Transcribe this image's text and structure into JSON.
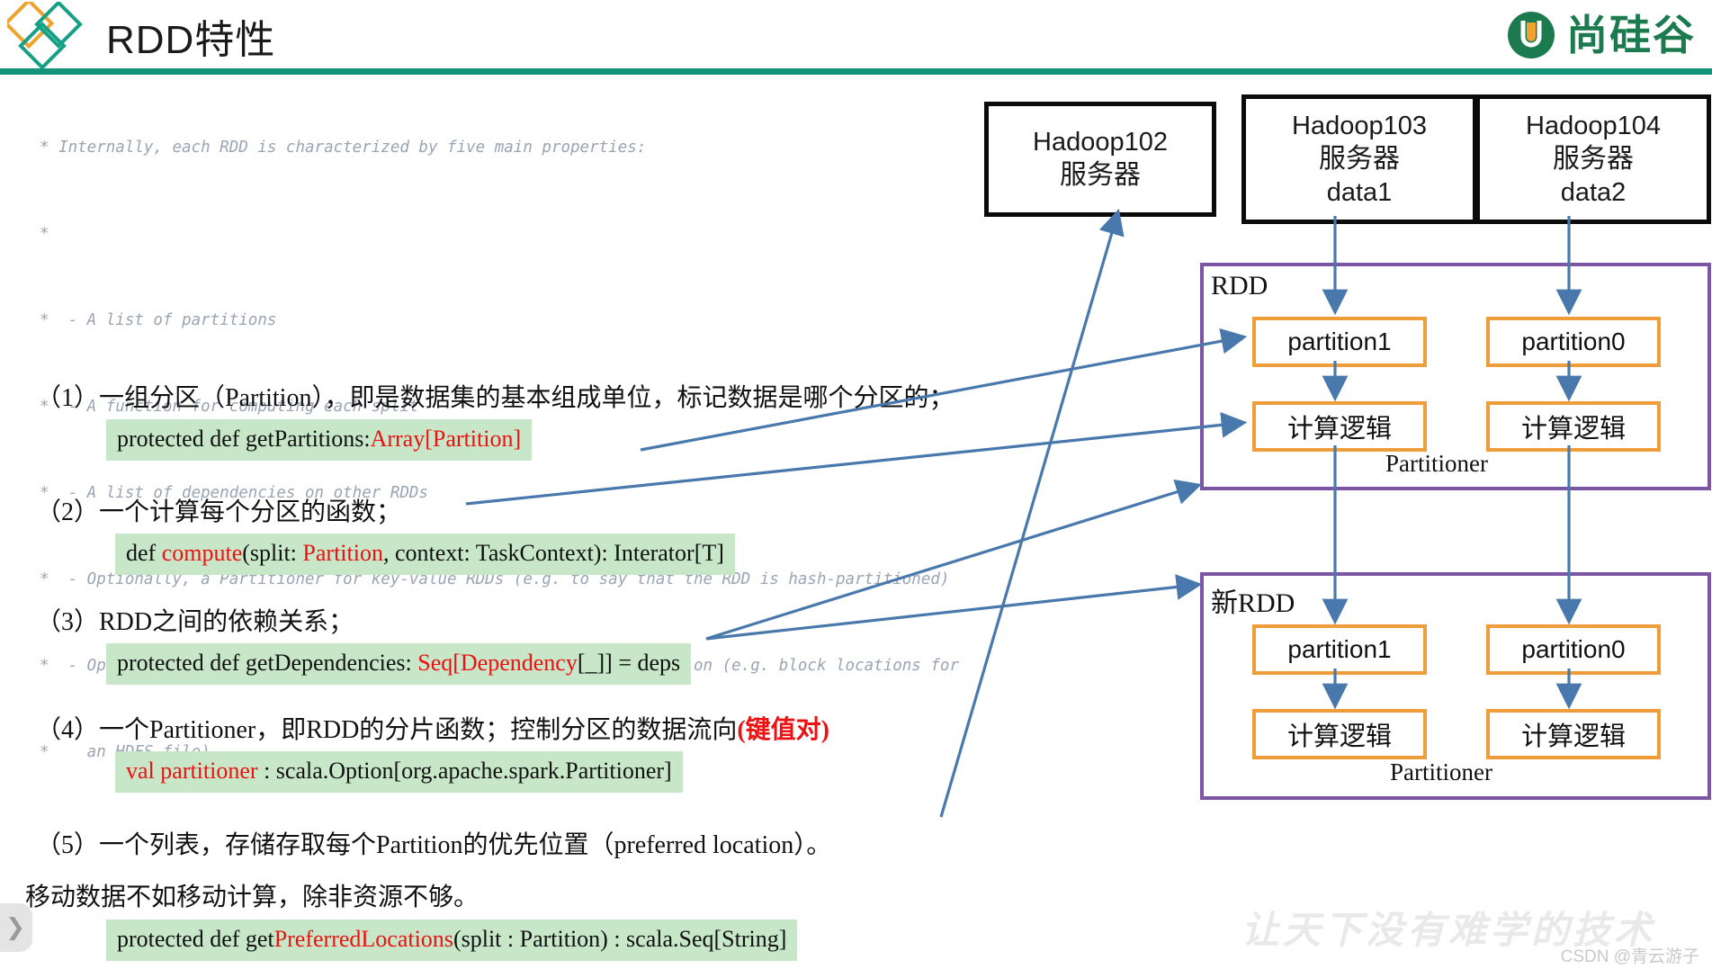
{
  "header": {
    "title": "RDD特性",
    "brand_text": "尚硅谷",
    "logo_icon": "diamonds-logo-icon",
    "brand_icon": "atguigu-u-icon",
    "rule_color": "#13937a",
    "diamond_colors": [
      "#f0a22e",
      "#16a085"
    ]
  },
  "comment": {
    "lines": [
      "* Internally, each RDD is characterized by five main properties:",
      "*",
      "*  - A list of partitions",
      "*  - A function for computing each split",
      "*  - A list of dependencies on other RDDs",
      "*  - Optionally, a Partitioner for key-value RDDs (e.g. to say that the RDD is hash-partitioned)",
      "*  - Optionally, a list of preferred locations to compute each split on (e.g. block locations for",
      "*    an HDFS file)"
    ],
    "color": "#9aa4b4"
  },
  "properties": [
    {
      "label": "（1）一组分区（Partition），即是数据集的基本组成单位，标记数据是哪个分区的；",
      "code_plain_1": "protected def getPartitions:",
      "code_red": "Array[Partition]",
      "code_plain_2": ""
    },
    {
      "label": "（2）一个计算每个分区的函数；",
      "code_plain_1": "def ",
      "code_red": "compute",
      "code_plain_2": "(split: ",
      "code_red_2": "Partition",
      "code_plain_3": ", context: TaskContext): Interator[T]"
    },
    {
      "label": "（3）RDD之间的依赖关系；",
      "code_plain_1": "protected def getDependencies: ",
      "code_red": "Seq[Dependency",
      "code_plain_2": "[_]] = deps"
    },
    {
      "label_plain": "（4）一个Partitioner，即RDD的分片函数；控制分区的数据流向",
      "label_red": "(键值对)",
      "code_red": "val partitioner",
      "code_plain_2": " : scala.Option[org.apache.spark.Partitioner]"
    },
    {
      "label": "（5）一个列表，存储存取每个Partition的优先位置（preferred location）。",
      "code_plain_1": "protected def get",
      "code_red": "PreferredLocations",
      "code_plain_2": "(split : Partition) : scala.Seq[String]"
    }
  ],
  "note": "移动数据不如移动计算，除非资源不够。",
  "diagram": {
    "servers": [
      {
        "name": "Hadoop102",
        "role": "服务器",
        "data": ""
      },
      {
        "name": "Hadoop103",
        "role": "服务器",
        "data": "data1"
      },
      {
        "name": "Hadoop104",
        "role": "服务器",
        "data": "data2"
      }
    ],
    "rdd_top": {
      "title": "RDD",
      "partitioner_label": "Partitioner",
      "left_partition": "partition1",
      "right_partition": "partition0",
      "left_logic": "计算逻辑",
      "right_logic": "计算逻辑"
    },
    "rdd_bottom": {
      "title": "新RDD",
      "partitioner_label": "Partitioner",
      "left_partition": "partition1",
      "right_partition": "partition0",
      "left_logic": "计算逻辑",
      "right_logic": "计算逻辑"
    },
    "colors": {
      "box_border": "#7c56a5",
      "partition_border": "#ef9d3a",
      "server_border": "#0b0b0b",
      "arrow": "#4878ac"
    }
  },
  "chrome": {
    "edge_tab_icon": "chevron-right-icon",
    "watermark": "让天下没有难学的技术",
    "credit": "CSDN @青云游子"
  }
}
